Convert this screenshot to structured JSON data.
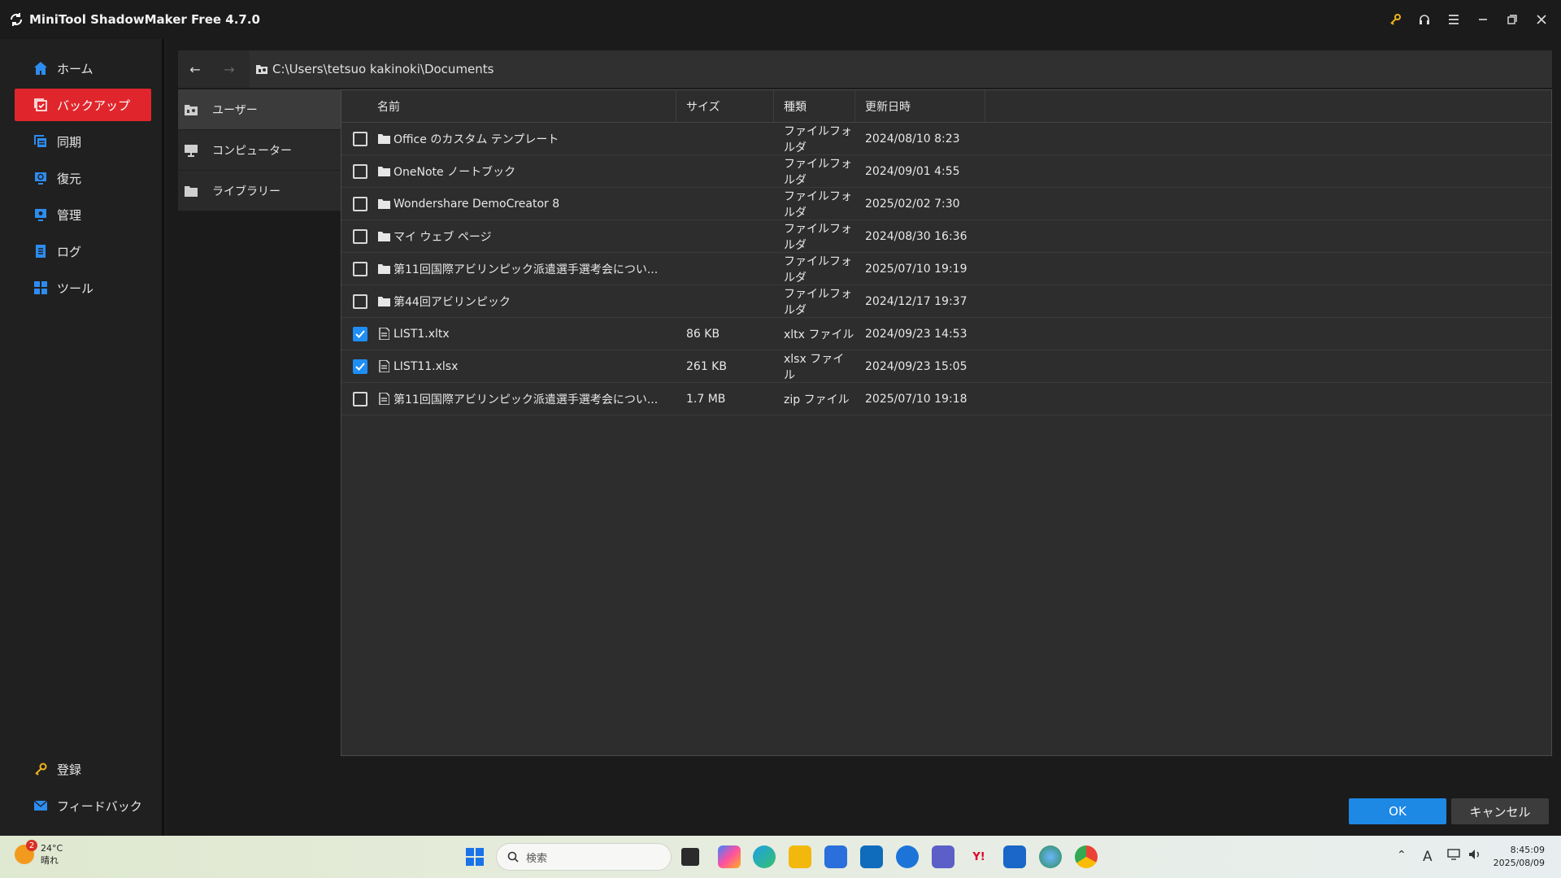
{
  "window": {
    "title": "MiniTool ShadowMaker Free 4.7.0"
  },
  "titlebar_icons": [
    "key-icon",
    "headphones-icon",
    "menu-icon",
    "minimize-icon",
    "restore-icon",
    "close-icon"
  ],
  "sidebar": {
    "items": [
      {
        "label": "ホーム",
        "icon": "home-icon",
        "active": false
      },
      {
        "label": "バックアップ",
        "icon": "backup-icon",
        "active": true
      },
      {
        "label": "同期",
        "icon": "sync-icon",
        "active": false
      },
      {
        "label": "復元",
        "icon": "restore-icon",
        "active": false
      },
      {
        "label": "管理",
        "icon": "manage-icon",
        "active": false
      },
      {
        "label": "ログ",
        "icon": "log-icon",
        "active": false
      },
      {
        "label": "ツール",
        "icon": "tools-icon",
        "active": false
      }
    ],
    "footer": [
      {
        "label": "登録",
        "icon": "key-icon"
      },
      {
        "label": "フィードバック",
        "icon": "mail-icon"
      }
    ]
  },
  "pathbar": {
    "back": "←",
    "forward": "→",
    "path": "C:\\Users\\tetsuo kakinoki\\Documents"
  },
  "sources": [
    {
      "label": "ユーザー",
      "icon": "user-folder-icon",
      "active": true
    },
    {
      "label": "コンピューター",
      "icon": "computer-icon",
      "active": false
    },
    {
      "label": "ライブラリー",
      "icon": "library-icon",
      "active": false
    }
  ],
  "filelist": {
    "columns": {
      "name": "名前",
      "size": "サイズ",
      "type": "種類",
      "date": "更新日時"
    },
    "rows": [
      {
        "name": "Office のカスタム テンプレート",
        "size": "",
        "type": "ファイルフォルダ",
        "date": "2024/08/10 8:23",
        "kind": "folder",
        "checked": false
      },
      {
        "name": "OneNote ノートブック",
        "size": "",
        "type": "ファイルフォルダ",
        "date": "2024/09/01 4:55",
        "kind": "folder",
        "checked": false
      },
      {
        "name": "Wondershare DemoCreator 8",
        "size": "",
        "type": "ファイルフォルダ",
        "date": "2025/02/02 7:30",
        "kind": "folder",
        "checked": false
      },
      {
        "name": "マイ ウェブ ページ",
        "size": "",
        "type": "ファイルフォルダ",
        "date": "2024/08/30 16:36",
        "kind": "folder",
        "checked": false
      },
      {
        "name": "第11回国際アビリンピック派遣選手選考会につい...",
        "size": "",
        "type": "ファイルフォルダ",
        "date": "2025/07/10 19:19",
        "kind": "folder",
        "checked": false
      },
      {
        "name": "第44回アビリンピック",
        "size": "",
        "type": "ファイルフォルダ",
        "date": "2024/12/17 19:37",
        "kind": "folder",
        "checked": false
      },
      {
        "name": "LIST1.xltx",
        "size": "86 KB",
        "type": "xltx ファイル",
        "date": "2024/09/23 14:53",
        "kind": "file",
        "checked": true
      },
      {
        "name": "LIST11.xlsx",
        "size": "261 KB",
        "type": "xlsx ファイル",
        "date": "2024/09/23 15:05",
        "kind": "file",
        "checked": true
      },
      {
        "name": "第11回国際アビリンピック派遣選手選考会につい...",
        "size": "1.7 MB",
        "type": "zip ファイル",
        "date": "2025/07/10 19:18",
        "kind": "file",
        "checked": false
      }
    ]
  },
  "buttons": {
    "ok": "OK",
    "cancel": "キャンセル"
  },
  "colors": {
    "accent_red": "#e0262c",
    "accent_blue": "#1e88e5",
    "checkbox_blue": "#1e8ef5"
  },
  "taskbar": {
    "weather_badge": "2",
    "temperature": "24°C",
    "condition": "晴れ",
    "search_placeholder": "検索",
    "apps": [
      "task-view-icon",
      "copilot-icon",
      "edge-icon",
      "file-explorer-icon",
      "store-icon",
      "outlook-icon",
      "shield-app-icon",
      "teams-icon",
      "yahoo-icon",
      "shadowmaker-icon",
      "globe-app-icon",
      "chrome-icon"
    ],
    "yahoo_label": "Y!",
    "ime": "A",
    "time": "8:45:09",
    "date": "2025/08/09"
  }
}
